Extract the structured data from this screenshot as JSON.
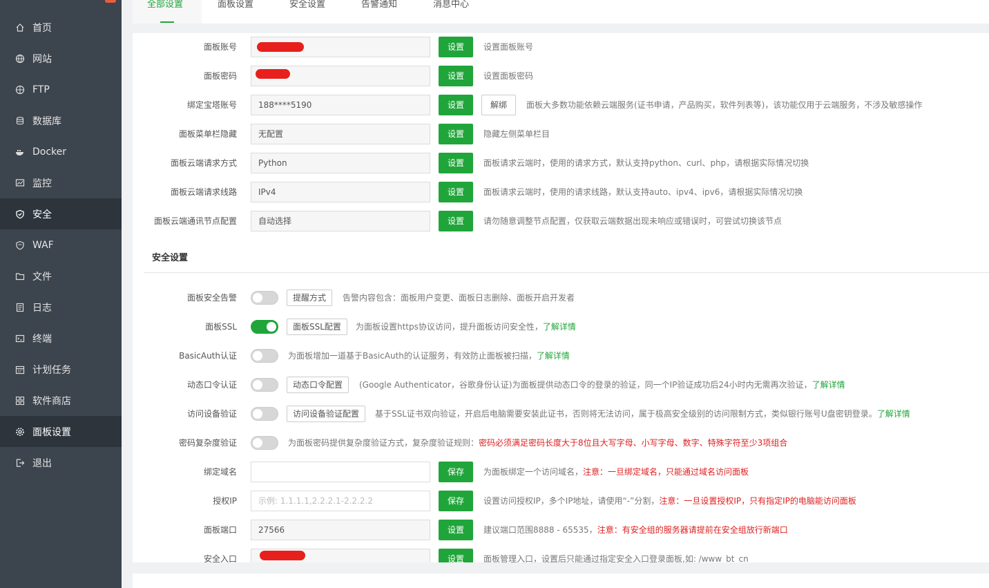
{
  "sidebar": {
    "items": [
      {
        "label": "首页",
        "icon": "home-icon"
      },
      {
        "label": "网站",
        "icon": "globe-icon"
      },
      {
        "label": "FTP",
        "icon": "ftp-icon"
      },
      {
        "label": "数据库",
        "icon": "database-icon"
      },
      {
        "label": "Docker",
        "icon": "docker-icon"
      },
      {
        "label": "监控",
        "icon": "monitor-icon"
      },
      {
        "label": "安全",
        "icon": "shield-icon"
      },
      {
        "label": "WAF",
        "icon": "waf-shield-icon"
      },
      {
        "label": "文件",
        "icon": "folder-icon"
      },
      {
        "label": "日志",
        "icon": "log-icon"
      },
      {
        "label": "终端",
        "icon": "terminal-icon"
      },
      {
        "label": "计划任务",
        "icon": "calendar-icon"
      },
      {
        "label": "软件商店",
        "icon": "grid-icon"
      },
      {
        "label": "面板设置",
        "icon": "gear-icon"
      },
      {
        "label": "退出",
        "icon": "logout-icon"
      }
    ],
    "active": [
      "安全",
      "面板设置"
    ]
  },
  "tabs": [
    "全部设置",
    "面板设置",
    "安全设置",
    "告警通知",
    "消息中心"
  ],
  "active_tab": "全部设置",
  "panel": {
    "rows": [
      {
        "label": "面板账号",
        "value": "",
        "button": "设置",
        "hint": "设置面板账号"
      },
      {
        "label": "面板密码",
        "value": "",
        "button": "设置",
        "hint": "设置面板密码"
      },
      {
        "label": "绑定宝塔账号",
        "value": "188****5190",
        "button": "设置",
        "extra": "解绑",
        "hint": "面板大多数功能依赖云端服务(证书申请，产品购买，软件列表等)，该功能仅用于云端服务，不涉及敏感操作"
      },
      {
        "label": "面板菜单栏隐藏",
        "value": "无配置",
        "button": "设置",
        "hint": "隐藏左侧菜单栏目"
      },
      {
        "label": "面板云端请求方式",
        "value": "Python",
        "button": "设置",
        "hint": "面板请求云端时，使用的请求方式，默认支持python、curl、php，请根据实际情况切换"
      },
      {
        "label": "面板云端请求线路",
        "value": "IPv4",
        "button": "设置",
        "hint": "面板请求云端时，使用的请求线路，默认支持auto、ipv4、ipv6，请根据实际情况切换"
      },
      {
        "label": "面板云端通讯节点配置",
        "value": "自动选择",
        "button": "设置",
        "hint": "请勿随意调整节点配置，仅获取云端数据出现未响应或错误时，可尝试切换该节点"
      }
    ],
    "security_title": "安全设置",
    "security": {
      "alert": {
        "label": "面板安全告警",
        "on": false,
        "config": "提醒方式",
        "hint": "告警内容包含：面板用户变更、面板日志删除、面板开启开发者"
      },
      "ssl": {
        "label": "面板SSL",
        "on": true,
        "config": "面板SSL配置",
        "hint": "为面板设置https协议访问，提升面板访问安全性，",
        "link": "了解详情"
      },
      "basicauth": {
        "label": "BasicAuth认证",
        "on": false,
        "hint": "为面板增加一道基于BasicAuth的认证服务，有效防止面板被扫描，",
        "link": "了解详情"
      },
      "totp": {
        "label": "动态口令认证",
        "on": false,
        "config": "动态口令配置",
        "hint": "(Google Authenticator，谷歌身份认证)为面板提供动态口令的登录的验证，同一个IP验证成功后24小时内无需再次验证，",
        "link": "了解详情"
      },
      "device": {
        "label": "访问设备验证",
        "on": false,
        "config": "访问设备验证配置",
        "hint": "基于SSL证书双向验证，开启后电脑需要安装此证书，否则将无法访问，属于极高安全级别的访问限制方式，类似银行账号U盘密钥登录。",
        "link": "了解详情"
      },
      "complexity": {
        "label": "密码复杂度验证",
        "on": false,
        "hint": "为面板密码提供复杂度验证方式，复杂度验证规则：",
        "warn": "密码必须满足密码长度大于8位且大写字母、小写字母、数字、特殊字符至少3项组合"
      },
      "domain": {
        "label": "绑定域名",
        "value": "",
        "button": "保存",
        "hint": "为面板绑定一个访问域名，",
        "warn": "注意：一旦绑定域名，只能通过域名访问面板"
      },
      "ip": {
        "label": "授权IP",
        "placeholder": "示例: 1.1.1.1,2.2.2.1-2.2.2.2",
        "button": "保存",
        "hint": "设置访问授权IP，多个IP地址，请使用“-”分割，",
        "warn": "注意：一旦设置授权IP，只有指定IP的电脑能访问面板"
      },
      "port": {
        "label": "面板端口",
        "value": "27566",
        "button": "设置",
        "hint": "建议端口范围8888 - 65535，",
        "warn": "注意：有安全组的服务器请提前在安全组放行新端口"
      },
      "entry": {
        "label": "安全入口",
        "value": "",
        "button": "设置",
        "hint": "面板管理入口，设置后只能通过指定安全入口登录面板,如: /www_bt_cn"
      }
    }
  },
  "colors": {
    "accent": "#20a53a",
    "sidebar": "#3c444d",
    "sidebar_active": "#2d343b",
    "warn": "#e02020",
    "redact": "#e8201d"
  }
}
